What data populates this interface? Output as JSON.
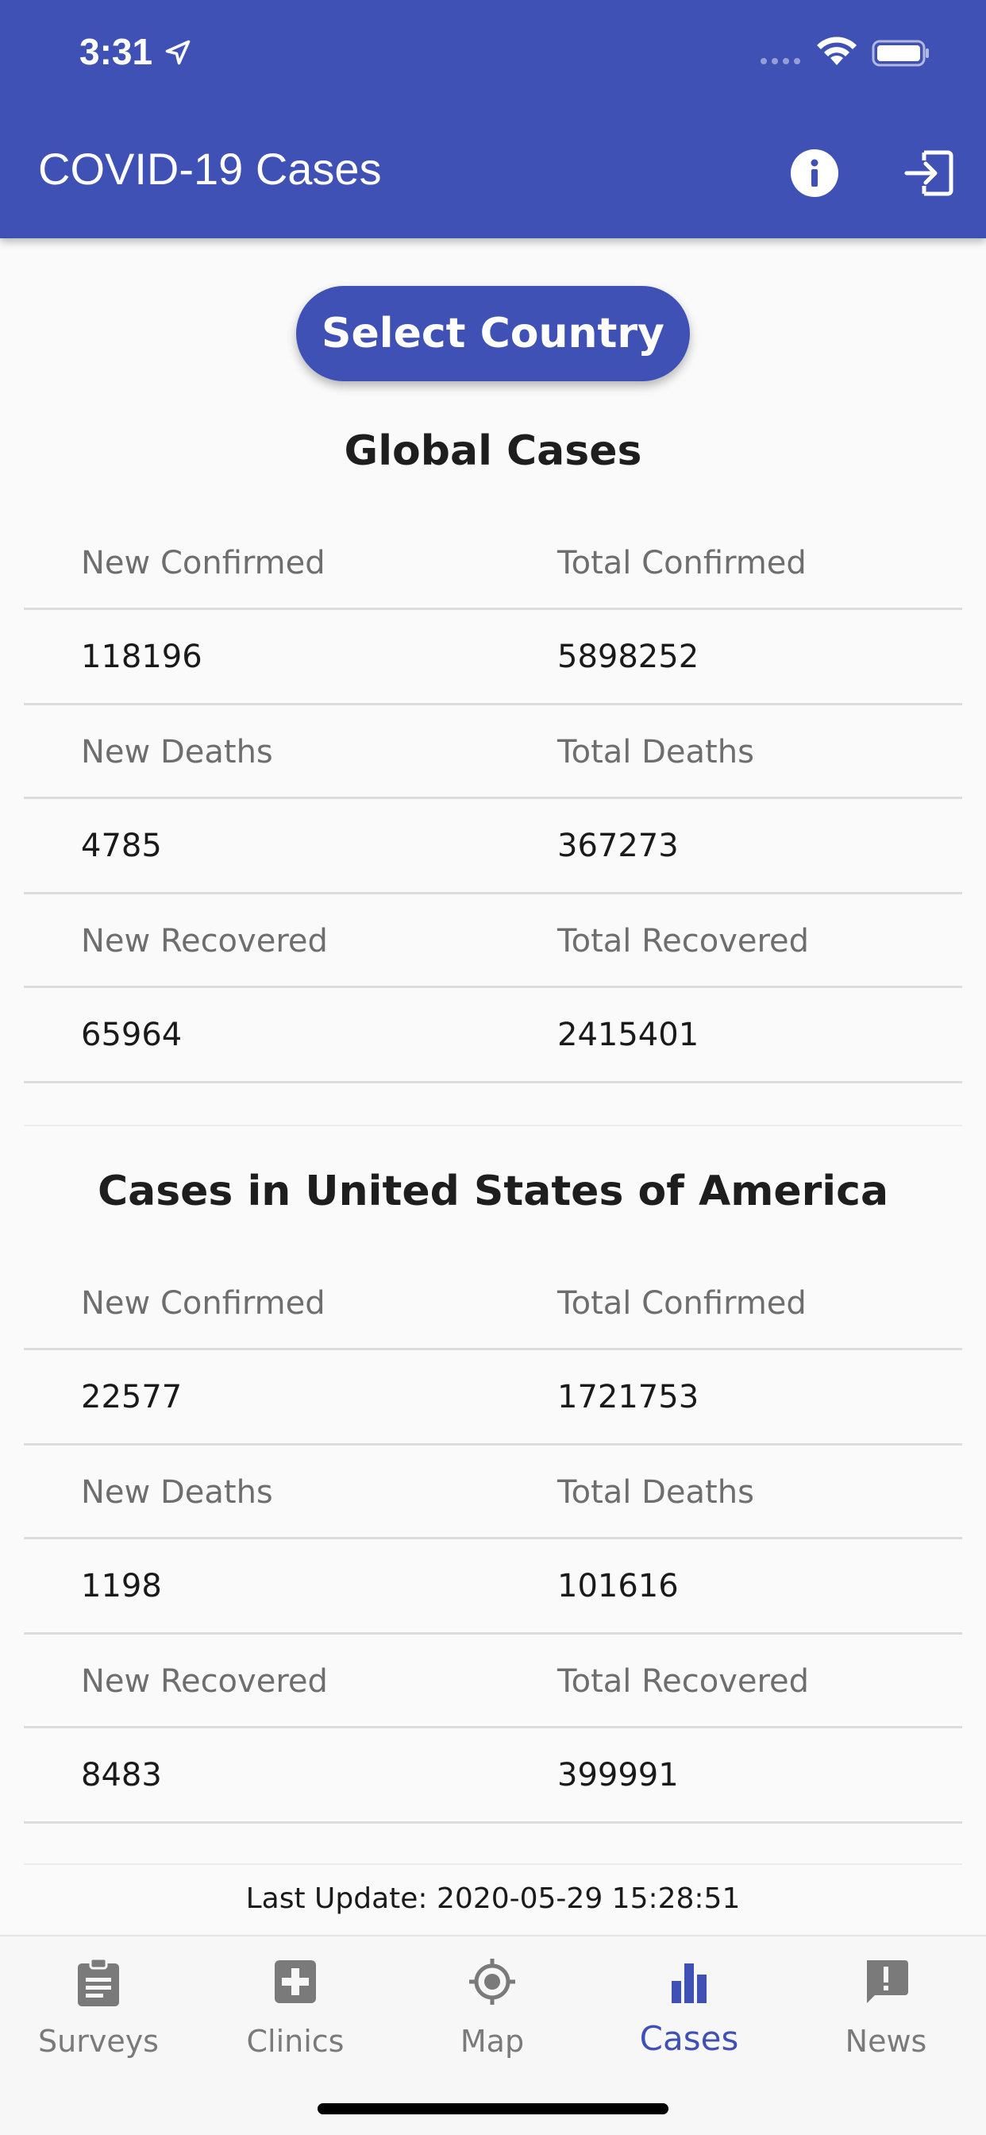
{
  "status": {
    "time": "3:31"
  },
  "appbar": {
    "title": "COVID-19 Cases"
  },
  "select_button": "Select Country",
  "global": {
    "title": "Global Cases",
    "rows": [
      {
        "left": "New Confirmed",
        "right": "Total Confirmed"
      },
      {
        "left": "118196",
        "right": "5898252"
      },
      {
        "left": "New Deaths",
        "right": "Total Deaths"
      },
      {
        "left": "4785",
        "right": "367273"
      },
      {
        "left": "New Recovered",
        "right": "Total Recovered"
      },
      {
        "left": "65964",
        "right": "2415401"
      }
    ]
  },
  "country": {
    "title": "Cases in United States of America",
    "rows": [
      {
        "left": "New Confirmed",
        "right": "Total Confirmed"
      },
      {
        "left": "22577",
        "right": "1721753"
      },
      {
        "left": "New Deaths",
        "right": "Total Deaths"
      },
      {
        "left": "1198",
        "right": "101616"
      },
      {
        "left": "New Recovered",
        "right": "Total Recovered"
      },
      {
        "left": "8483",
        "right": "399991"
      }
    ]
  },
  "last_update": "Last Update: 2020-05-29 15:28:51",
  "nav": [
    {
      "label": "Surveys",
      "icon": "clipboard-icon"
    },
    {
      "label": "Clinics",
      "icon": "medical-cross-icon"
    },
    {
      "label": "Map",
      "icon": "location-target-icon"
    },
    {
      "label": "Cases",
      "icon": "bar-chart-icon",
      "active": true
    },
    {
      "label": "News",
      "icon": "alert-message-icon"
    }
  ],
  "colors": {
    "primary": "#3f51b5",
    "background": "#fafafa",
    "label_gray": "#6e6e6e"
  }
}
